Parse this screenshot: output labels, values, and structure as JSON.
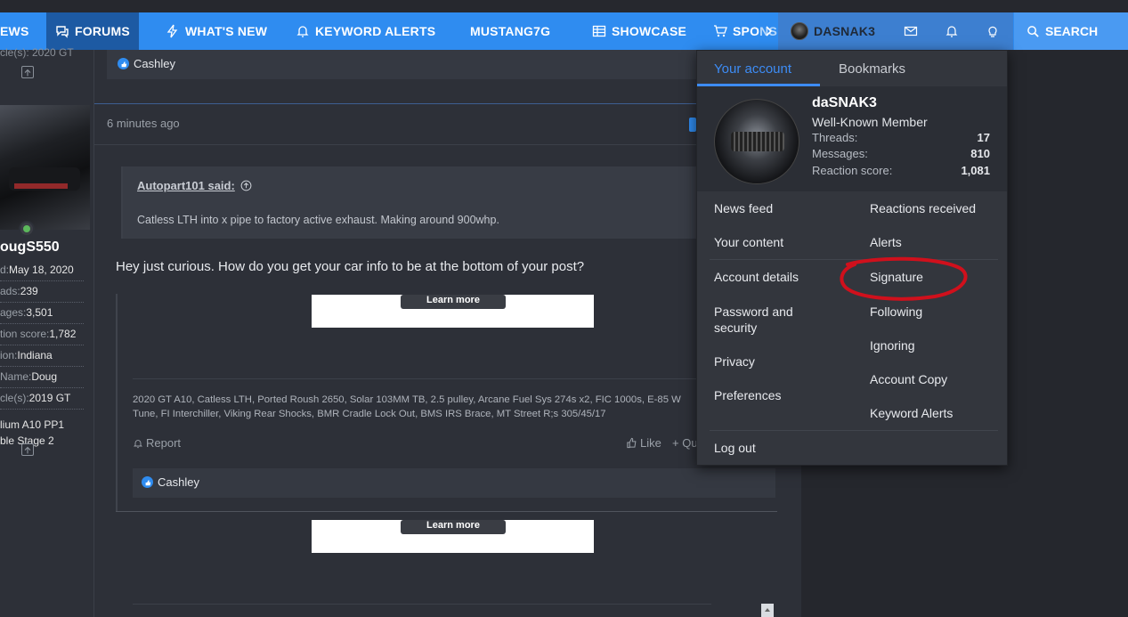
{
  "nav": {
    "news": "EWS",
    "forums": "FORUMS",
    "whats_new": "WHAT'S NEW",
    "keyword_alerts": "KEYWORD ALERTS",
    "mustang7g": "MUSTANG7G",
    "showcase": "SHOWCASE",
    "sponsors": "SPONS",
    "account": "DASNAK3",
    "search": "SEARCH"
  },
  "leftcol": {
    "prev_vehicle_line": "cle(s): 2020 GT",
    "username": "ougS550",
    "stats": [
      {
        "k": "d:",
        "v": "May 18, 2020"
      },
      {
        "k": "ads:",
        "v": "239"
      },
      {
        "k": "ages:",
        "v": "3,501"
      },
      {
        "k": "tion score:",
        "v": "1,782"
      },
      {
        "k": "ion:",
        "v": "Indiana"
      },
      {
        "k": "Name:",
        "v": "Doug"
      },
      {
        "k": "cle(s):",
        "v": "2019 GT"
      }
    ],
    "vehicle_line2": "lium A10 PP1",
    "vehicle_line3": "ble Stage 2"
  },
  "post": {
    "prev_reaction_user": "Cashley",
    "time": "6 minutes ago",
    "quote_author": "Autopart101 said:",
    "quote_text": "Catless LTH into x pipe to factory active exhaust. Making around 900whp.",
    "body": "Hey just curious. How do you get your car info to be at the bottom of your post?",
    "ad_button": "Learn more",
    "signature": "2020 GT A10, Catless LTH, Ported Roush 2650, Solar 103MM TB, 2.5 pulley, Arcane Fuel Sys 274s x2, FIC 1000s, E-85 W Tune, FI Interchiller, Viking Rear Shocks, BMR Cradle Lock Out, BMS IRS Brace, MT Street R;s 305/45/17",
    "report": "Report",
    "like": "Like",
    "quote": "+ Qu",
    "reaction_user": "Cashley",
    "ad_button2": "Learn more"
  },
  "dropdown": {
    "tab_account": "Your account",
    "tab_bookmarks": "Bookmarks",
    "username": "daSNAK3",
    "title": "Well-Known Member",
    "threads_label": "Threads:",
    "threads_value": "17",
    "messages_label": "Messages:",
    "messages_value": "810",
    "reaction_label": "Reaction score:",
    "reaction_value": "1,081",
    "left_items": [
      "News feed",
      "Your content",
      "Account details",
      "Password and",
      "security",
      "Privacy",
      "Preferences"
    ],
    "right_items": [
      "Reactions received",
      "Alerts",
      "Signature",
      "Following",
      "Ignoring",
      "Account Copy",
      "Keyword Alerts"
    ],
    "logout": "Log out"
  },
  "colors": {
    "nav_blue": "#2f8cf0",
    "accent": "#3d8cf5",
    "circle_annotation": "#d0101c"
  }
}
